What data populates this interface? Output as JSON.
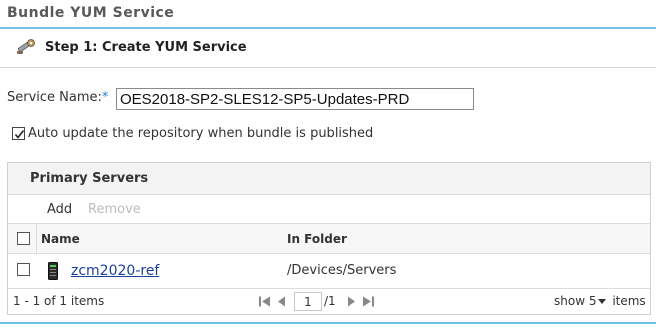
{
  "page": {
    "title": "Bundle YUM Service"
  },
  "step": {
    "icon": "wrench-icon",
    "title": "Step 1: Create YUM Service"
  },
  "form": {
    "service_name_label": "Service Name:",
    "required_marker": "*",
    "service_name_value": "OES2018-SP2-SLES12-SP5-Updates-PRD",
    "auto_update_checked": true,
    "auto_update_label": "Auto update the repository when bundle is published"
  },
  "primary_servers": {
    "title": "Primary Servers",
    "toolbar": {
      "add_label": "Add",
      "remove_label": "Remove"
    },
    "columns": {
      "name": "Name",
      "folder": "In Folder"
    },
    "rows": [
      {
        "name": "zcm2020-ref",
        "folder": "/Devices/Servers",
        "icon": "server-device-icon",
        "checked": false
      }
    ],
    "pager": {
      "count_text": "1 - 1 of 1 items",
      "page_value": "1",
      "total_text": "/1",
      "show_label": "show",
      "show_value": "5",
      "items_label": "items"
    }
  },
  "colors": {
    "accent_rule": "#6fc1e6",
    "link": "#1a3f9e",
    "required": "#2d7fd6"
  }
}
